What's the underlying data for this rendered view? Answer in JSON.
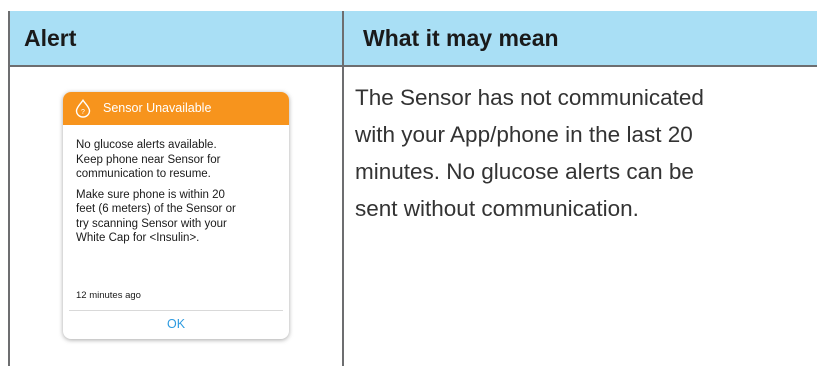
{
  "table": {
    "headers": {
      "alert": "Alert",
      "meaning": "What it may mean"
    },
    "meaning_text": "The Sensor has not communicated\nwith your App/phone in the last 20\nminutes. No glucose alerts can be\nsent without communication."
  },
  "alert_card": {
    "icon": "water-drop-question-icon",
    "title": "Sensor Unavailable",
    "paragraph_1": "No glucose alerts available.\nKeep phone near Sensor for\ncommunication to resume.",
    "paragraph_2": "Make sure phone is within 20\nfeet (6 meters) of the Sensor or\ntry scanning Sensor with your\nWhite Cap for <Insulin>.",
    "timestamp": "12 minutes ago",
    "ok_label": "OK"
  },
  "colors": {
    "header_bg": "#a9dff5",
    "alert_orange": "#f7941d",
    "ok_blue": "#2e9be0"
  }
}
